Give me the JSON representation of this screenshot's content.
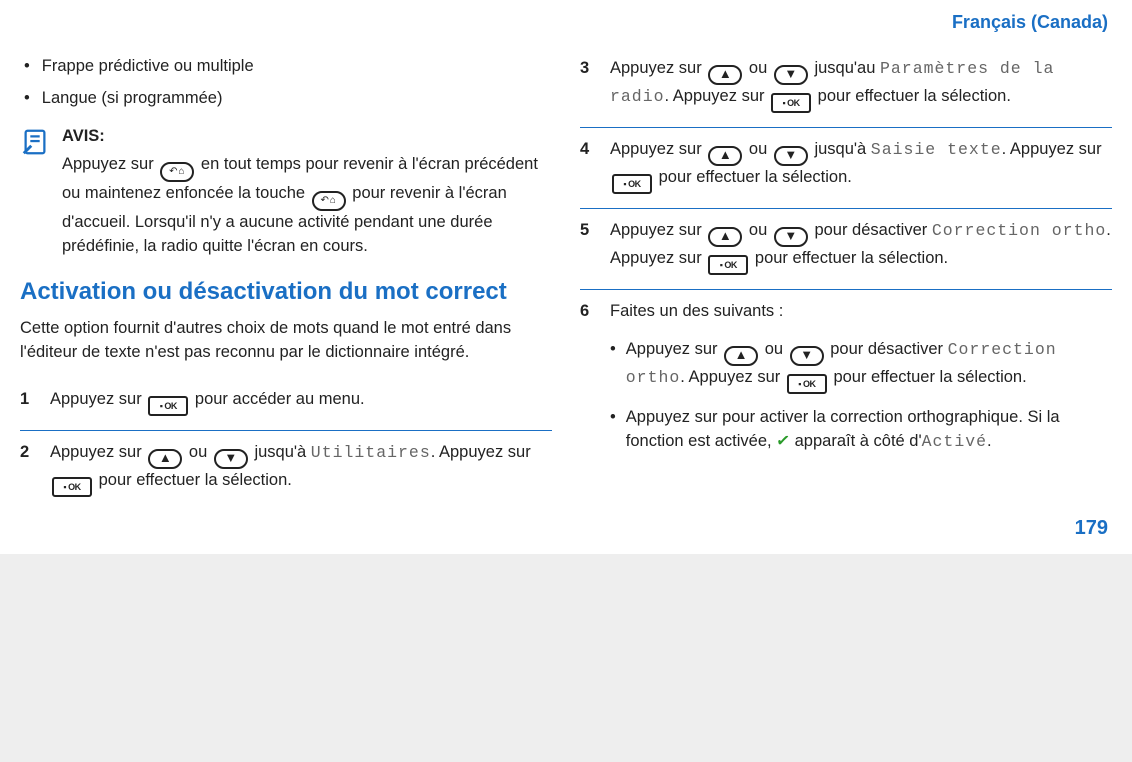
{
  "header": {
    "language": "Français (Canada)"
  },
  "page_number": "179",
  "left": {
    "bullet1": "Frappe prédictive ou multiple",
    "bullet2": "Langue (si programmée)",
    "notice_title": "AVIS:",
    "notice_p1a": "Appuyez sur ",
    "notice_p1b": " en tout temps pour revenir à l'écran précédent ou maintenez enfoncée la touche ",
    "notice_p2b": " pour revenir à l'écran d'accueil. Lorsqu'il n'y a aucune activité pendant une durée prédéfinie, la radio quitte l'écran en cours.",
    "heading": "Activation ou désactivation du mot correct",
    "intro": "Cette option fournit d'autres choix de mots quand le mot entré dans l'éditeur de texte n'est pas reconnu par le dictionnaire intégré.",
    "s1_num": "1",
    "s1a": "Appuyez sur ",
    "s1b": " pour accéder au menu.",
    "s2_num": "2",
    "s2a": "Appuyez sur ",
    "s2_ou": " ou ",
    "s2b": " jusqu'à ",
    "s2_code": "Utilitaires",
    "s2c": ". Appuyez sur ",
    "s2d": " pour effectuer la sélection."
  },
  "right": {
    "s3_num": "3",
    "s3a": "Appuyez sur ",
    "ou": " ou ",
    "s3b": " jusqu'au ",
    "s3_code": "Paramètres de la radio",
    "s3c": ". Appuyez sur ",
    "s3d": " pour effectuer la sélection.",
    "s4_num": "4",
    "s4a": "Appuyez sur ",
    "s4b": " jusqu'à ",
    "s4_code": "Saisie texte",
    "s4c": ". Appuyez sur ",
    "s4d": " pour effectuer la sélection.",
    "s5_num": "5",
    "s5a": "Appuyez sur ",
    "s5b": " pour désactiver ",
    "s5_code": "Correction ortho",
    "s5c": ". Appuyez sur ",
    "s5d": " pour effectuer la sélection.",
    "s6_num": "6",
    "s6_intro": "Faites un des suivants :",
    "s6_b1a": "Appuyez sur ",
    "s6_b1b": " pour désactiver ",
    "s6_b1_code": "Correction ortho",
    "s6_b1c": ". Appuyez sur ",
    "s6_b1d": " pour effectuer la sélection.",
    "s6_b2a": "Appuyez sur pour activer la correction orthographique. Si la fonction est activée, ",
    "s6_b2b": " apparaît à côté d'",
    "s6_b2_code": "Activé",
    "s6_b2c": "."
  },
  "key": {
    "ok": "▪ OK",
    "up": "▲",
    "down": "▼",
    "back": "↶⌂"
  }
}
